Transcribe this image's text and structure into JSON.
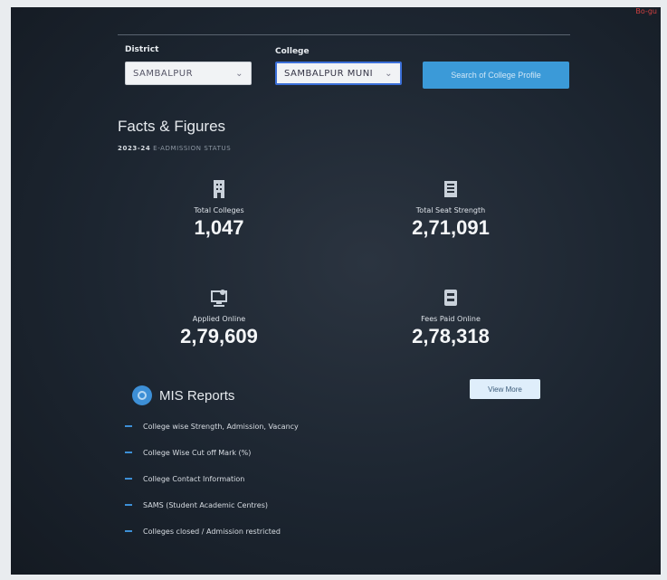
{
  "corner_mark": "Bo-gu",
  "filters": {
    "district_label": "District",
    "district_value": "SAMBALPUR",
    "college_label": "College",
    "college_value": "SAMBALPUR MUNI",
    "search_button": "Search of College Profile"
  },
  "facts": {
    "title": "Facts & Figures",
    "year": "2023-24",
    "year_note": "E-ADMISSION STATUS"
  },
  "stats": [
    {
      "label": "Total Colleges",
      "value": "1,047",
      "icon": "building-icon"
    },
    {
      "label": "Total Seat Strength",
      "value": "2,71,091",
      "icon": "register-icon"
    },
    {
      "label": "Applied Online",
      "value": "2,79,609",
      "icon": "monitor-icon"
    },
    {
      "label": "Fees Paid Online",
      "value": "2,78,318",
      "icon": "receipt-icon"
    }
  ],
  "mis": {
    "title": "MIS Reports",
    "view_more": "View More",
    "items": [
      "College wise Strength, Admission, Vacancy",
      "College Wise Cut off Mark (%)",
      "College Contact Information",
      "SAMS (Student Academic Centres)",
      "Colleges closed / Admission restricted"
    ]
  },
  "colors": {
    "accent": "#3b9ad8",
    "background": "#1c2530"
  }
}
